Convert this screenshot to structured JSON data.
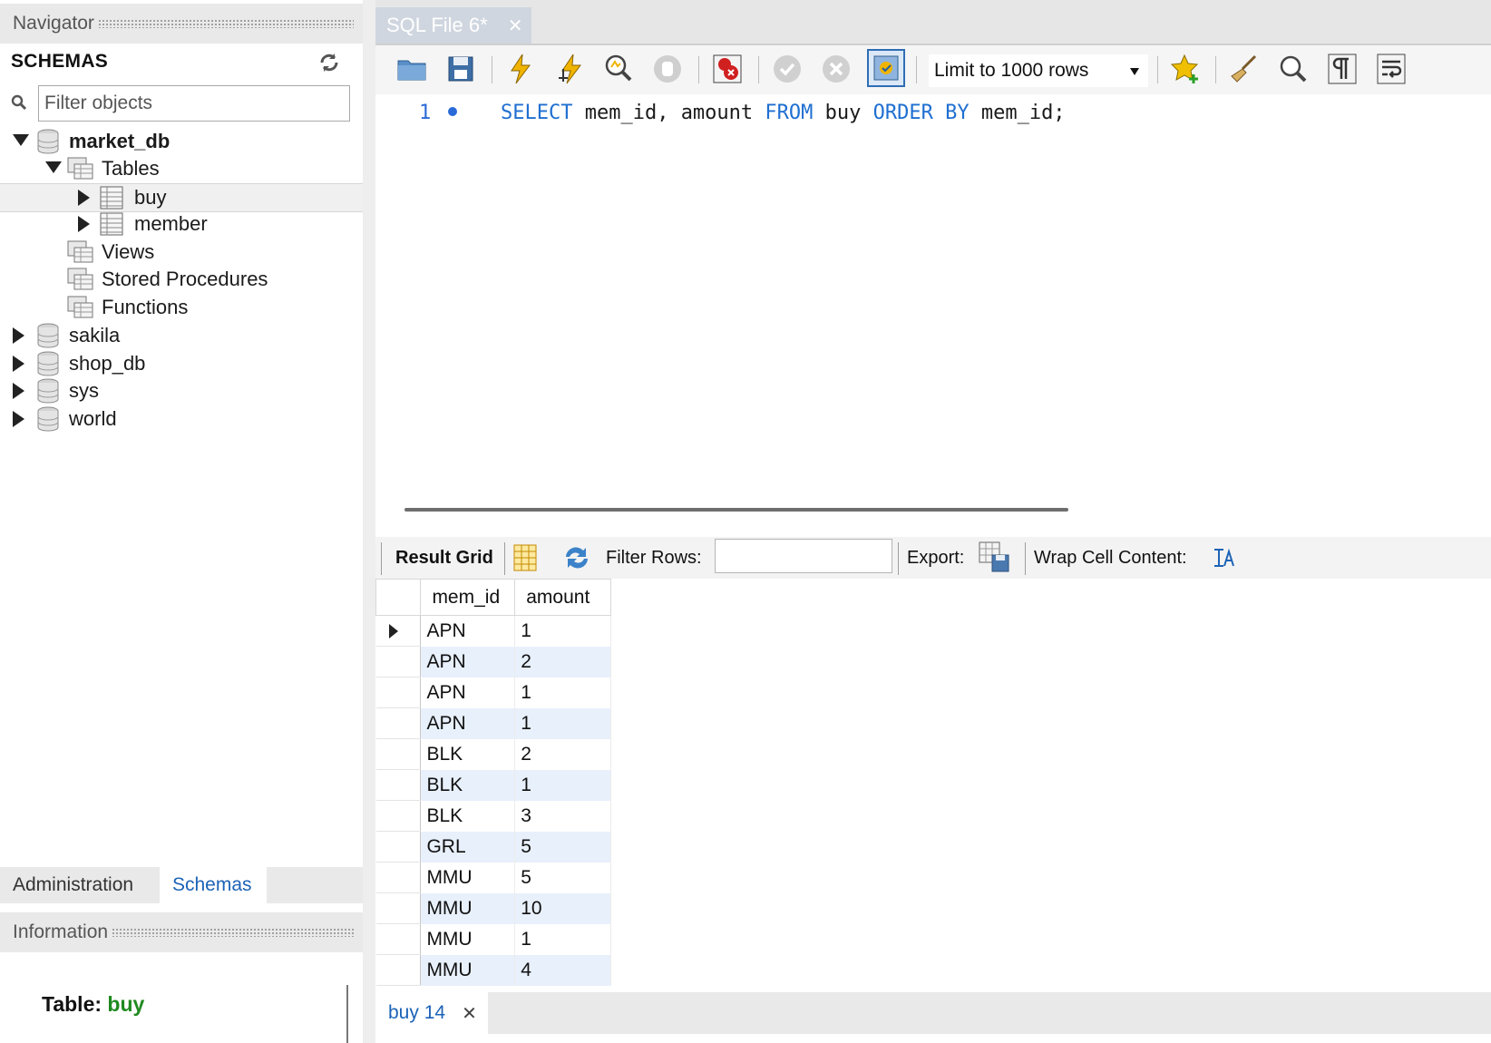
{
  "navigator": {
    "header": "Navigator",
    "schemas_title": "SCHEMAS",
    "filter_placeholder": "Filter objects",
    "tree": {
      "market_db": "market_db",
      "tables": "Tables",
      "buy": "buy",
      "member": "member",
      "views": "Views",
      "stored_procedures": "Stored Procedures",
      "functions": "Functions",
      "sakila": "sakila",
      "shop_db": "shop_db",
      "sys": "sys",
      "world": "world"
    },
    "bottom_tabs": {
      "administration": "Administration",
      "schemas": "Schemas"
    },
    "information_header": "Information",
    "info": {
      "table_label": "Table:",
      "table_name": "buy"
    }
  },
  "editor": {
    "tab_title": "SQL File 6*",
    "limit_label": "Limit to 1000 rows",
    "line_number": "1",
    "sql": {
      "select": "SELECT",
      "cols": " mem_id, amount ",
      "from": "FROM",
      "table": " buy ",
      "order_by": "ORDER BY",
      "tail": " mem_id;"
    }
  },
  "result": {
    "toolbar": {
      "result_grid": "Result Grid",
      "filter_rows": "Filter Rows:",
      "export": "Export:",
      "wrap": "Wrap Cell Content:"
    },
    "columns": [
      "mem_id",
      "amount"
    ],
    "rows": [
      [
        "APN",
        "1"
      ],
      [
        "APN",
        "2"
      ],
      [
        "APN",
        "1"
      ],
      [
        "APN",
        "1"
      ],
      [
        "BLK",
        "2"
      ],
      [
        "BLK",
        "1"
      ],
      [
        "BLK",
        "3"
      ],
      [
        "GRL",
        "5"
      ],
      [
        "MMU",
        "5"
      ],
      [
        "MMU",
        "10"
      ],
      [
        "MMU",
        "1"
      ],
      [
        "MMU",
        "4"
      ]
    ],
    "tab_label": "buy 14"
  },
  "colors": {
    "keyword": "#1f6fd1",
    "accent": "#1c63b7",
    "alt_row": "#e8f0fb",
    "info_green": "#1f8a1f"
  }
}
